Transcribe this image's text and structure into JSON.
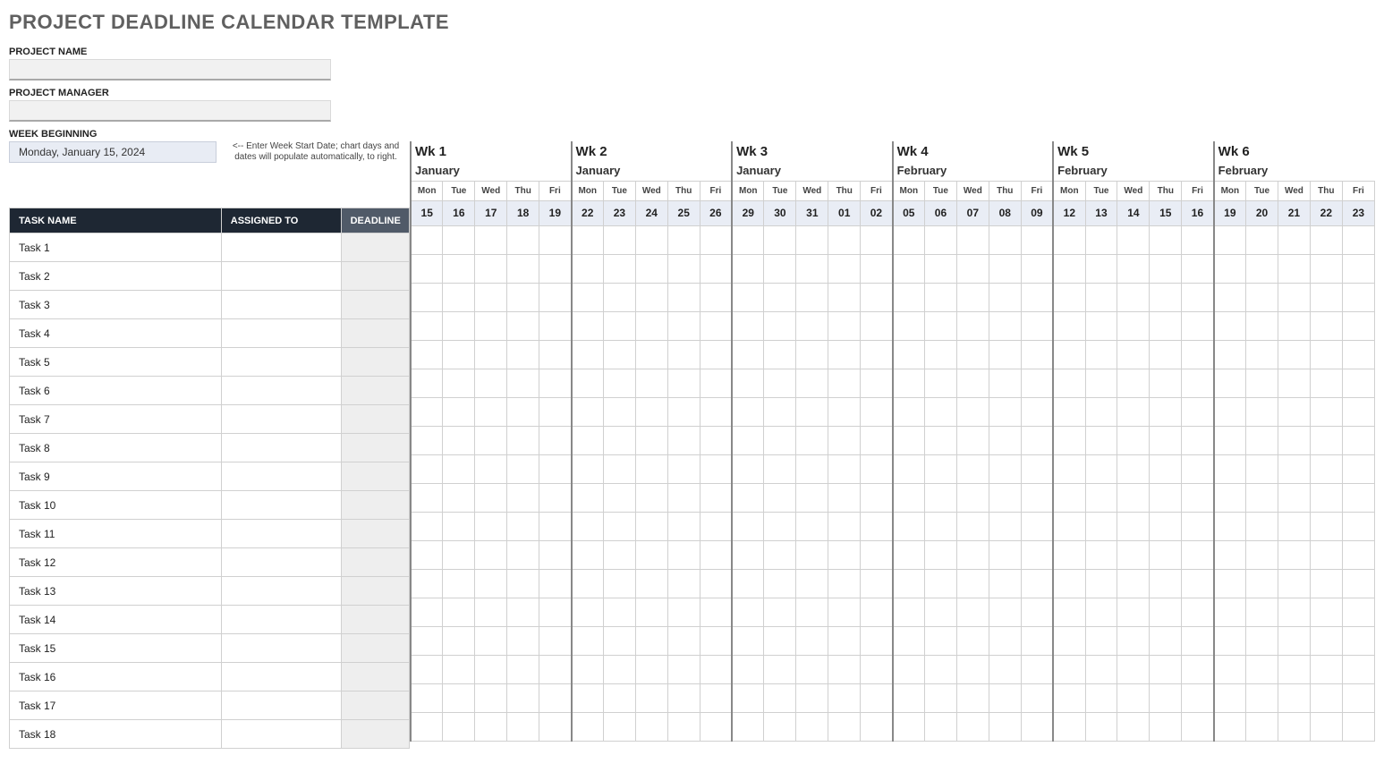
{
  "title": "PROJECT DEADLINE CALENDAR TEMPLATE",
  "labels": {
    "project_name": "PROJECT NAME",
    "project_manager": "PROJECT MANAGER",
    "week_beginning": "WEEK BEGINNING"
  },
  "inputs": {
    "project_name": "",
    "project_manager": "",
    "week_beginning": "Monday, January 15, 2024"
  },
  "hint": "<-- Enter Week Start Date; chart days and dates will populate automatically, to right.",
  "columns": {
    "task_name": "TASK NAME",
    "assigned_to": "ASSIGNED TO",
    "deadline": "DEADLINE"
  },
  "days": [
    "Mon",
    "Tue",
    "Wed",
    "Thu",
    "Fri"
  ],
  "weeks": [
    {
      "label": "Wk 1",
      "month": "January",
      "dates": [
        "15",
        "16",
        "17",
        "18",
        "19"
      ]
    },
    {
      "label": "Wk 2",
      "month": "January",
      "dates": [
        "22",
        "23",
        "24",
        "25",
        "26"
      ]
    },
    {
      "label": "Wk 3",
      "month": "January",
      "dates": [
        "29",
        "30",
        "31",
        "01",
        "02"
      ]
    },
    {
      "label": "Wk 4",
      "month": "February",
      "dates": [
        "05",
        "06",
        "07",
        "08",
        "09"
      ]
    },
    {
      "label": "Wk 5",
      "month": "February",
      "dates": [
        "12",
        "13",
        "14",
        "15",
        "16"
      ]
    },
    {
      "label": "Wk 6",
      "month": "February",
      "dates": [
        "19",
        "20",
        "21",
        "22",
        "23"
      ]
    }
  ],
  "tasks": [
    {
      "name": "Task 1",
      "assigned_to": "",
      "deadline": ""
    },
    {
      "name": "Task 2",
      "assigned_to": "",
      "deadline": ""
    },
    {
      "name": "Task 3",
      "assigned_to": "",
      "deadline": ""
    },
    {
      "name": "Task 4",
      "assigned_to": "",
      "deadline": ""
    },
    {
      "name": "Task 5",
      "assigned_to": "",
      "deadline": ""
    },
    {
      "name": "Task 6",
      "assigned_to": "",
      "deadline": ""
    },
    {
      "name": "Task 7",
      "assigned_to": "",
      "deadline": ""
    },
    {
      "name": "Task 8",
      "assigned_to": "",
      "deadline": ""
    },
    {
      "name": "Task 9",
      "assigned_to": "",
      "deadline": ""
    },
    {
      "name": "Task 10",
      "assigned_to": "",
      "deadline": ""
    },
    {
      "name": "Task 11",
      "assigned_to": "",
      "deadline": ""
    },
    {
      "name": "Task 12",
      "assigned_to": "",
      "deadline": ""
    },
    {
      "name": "Task 13",
      "assigned_to": "",
      "deadline": ""
    },
    {
      "name": "Task 14",
      "assigned_to": "",
      "deadline": ""
    },
    {
      "name": "Task 15",
      "assigned_to": "",
      "deadline": ""
    },
    {
      "name": "Task 16",
      "assigned_to": "",
      "deadline": ""
    },
    {
      "name": "Task 17",
      "assigned_to": "",
      "deadline": ""
    },
    {
      "name": "Task 18",
      "assigned_to": "",
      "deadline": ""
    }
  ]
}
